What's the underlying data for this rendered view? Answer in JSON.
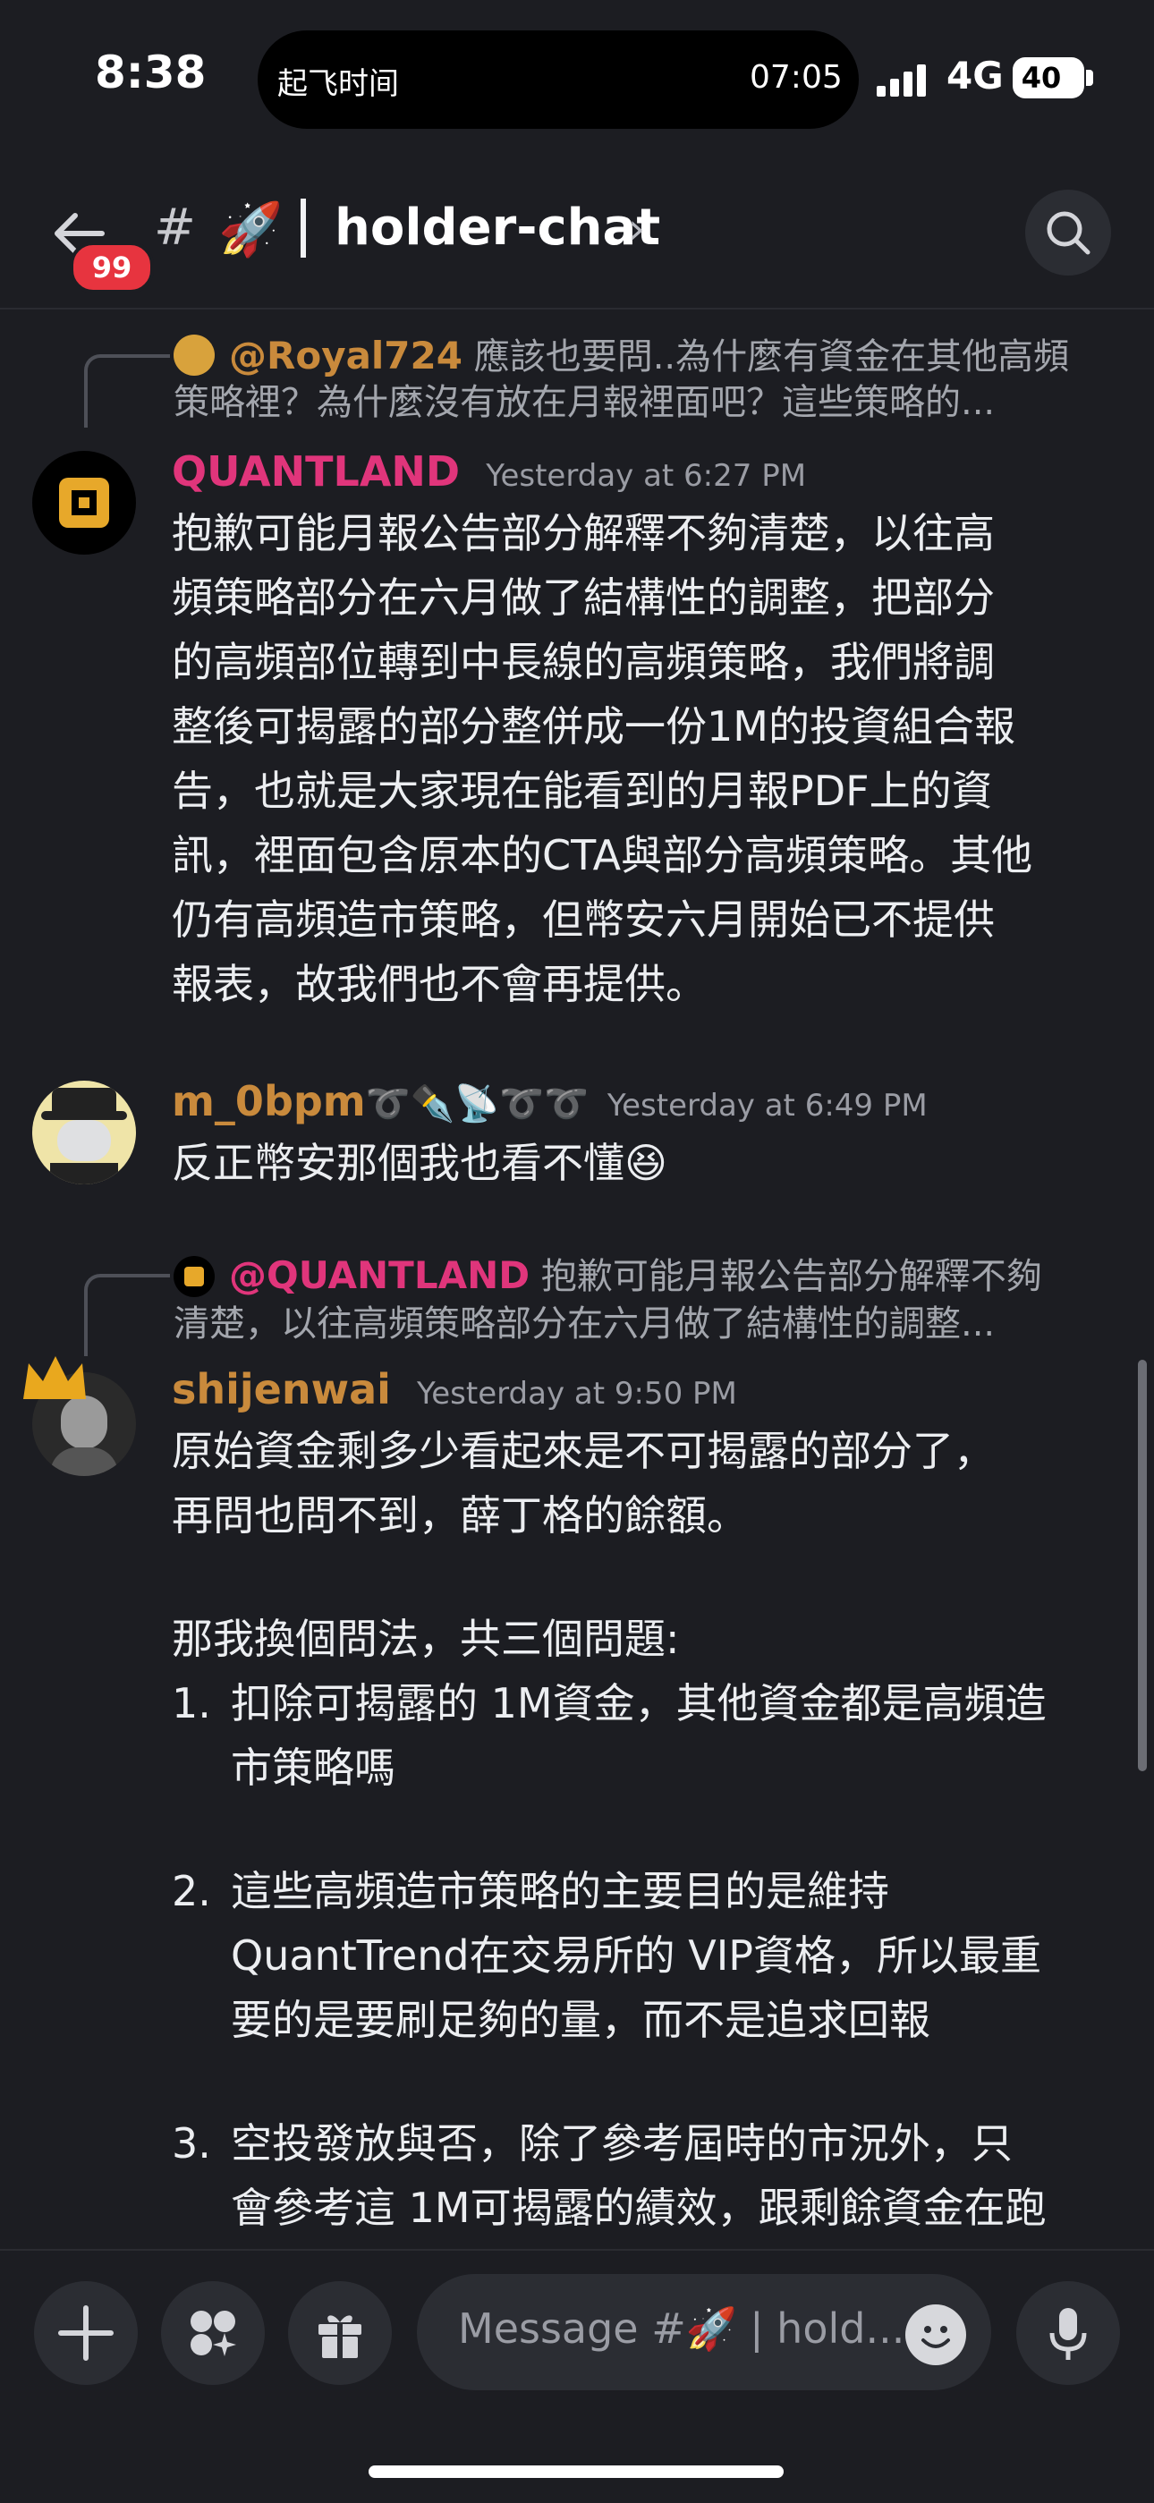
{
  "status_bar": {
    "time": "8:38",
    "island_label": "起飞时间",
    "island_time": "07:05",
    "network": "4G",
    "battery": "40"
  },
  "header": {
    "unread_badge": "99",
    "hash_symbol": "#",
    "channel_emoji": "🚀",
    "channel_name": "holder-chat",
    "chevron": "›"
  },
  "messages": [
    {
      "reply_to": {
        "mention": "@Royal724",
        "preview_line1": "應該也要問..為什麼有資金在其他高頻",
        "preview_line2": "策略裡？為什麼沒有放在月報裡面吧？這些策略的..."
      },
      "author": "QUANTLAND",
      "author_color": "#e0357b",
      "timestamp": "Yesterday at 6:27 PM",
      "lines": [
        "抱歉可能月報公告部分解釋不夠清楚，以往高",
        "頻策略部分在六月做了結構性的調整，把部分",
        "的高頻部位轉到中長線的高頻策略，我們將調",
        "整後可揭露的部分整併成一份1M的投資組合報",
        "告，也就是大家現在能看到的月報PDF上的資",
        "訊，裡面包含原本的CTA與部分高頻策略。其他",
        "仍有高頻造市策略，但幣安六月開始已不提供",
        "報表，故我們也不會再提供。"
      ]
    },
    {
      "author": "m_0bpm",
      "author_decor": "➰✒️📡➰➰",
      "author_color": "#c98a3c",
      "timestamp": "Yesterday at 6:49 PM",
      "lines": [
        "反正幣安那個我也看不懂😆"
      ]
    },
    {
      "reply_to": {
        "mention": "@QUANTLAND",
        "preview_line1": "抱歉可能月報公告部分解釋不夠",
        "preview_line2": "清楚，以往高頻策略部分在六月做了結構性的調整..."
      },
      "author": "shijenwai",
      "author_color": "#c98a3c",
      "timestamp": "Yesterday at 9:50 PM",
      "lines": [
        "原始資金剩多少看起來是不可揭露的部分了，",
        "再問也問不到，薛丁格的餘額。",
        "那我換個問法，共三個問題:"
      ],
      "list": [
        {
          "num": "1.",
          "lines": [
            "扣除可揭露的 1M資金，其他資金都是高頻造",
            "市策略嗎"
          ]
        },
        {
          "num": "2.",
          "lines": [
            "這些高頻造市策略的主要目的是維持",
            "QuantTrend在交易所的 VIP資格，所以最重",
            "要的是要刷足夠的量，而不是追求回報"
          ]
        },
        {
          "num": "3.",
          "lines": [
            "空投發放與否，除了參考屆時的市況外，只",
            "會參考這 1M可揭露的績效，跟剩餘資金在跑"
          ]
        }
      ]
    }
  ],
  "composer": {
    "placeholder_prefix": "Message #",
    "placeholder_emoji": "🚀",
    "placeholder_suffix": "| hold..."
  },
  "icons": [
    "back-arrow-icon",
    "search-icon",
    "plus-icon",
    "apps-icon",
    "gift-icon",
    "emoji-icon",
    "microphone-icon",
    "signal-icon",
    "battery-icon"
  ]
}
